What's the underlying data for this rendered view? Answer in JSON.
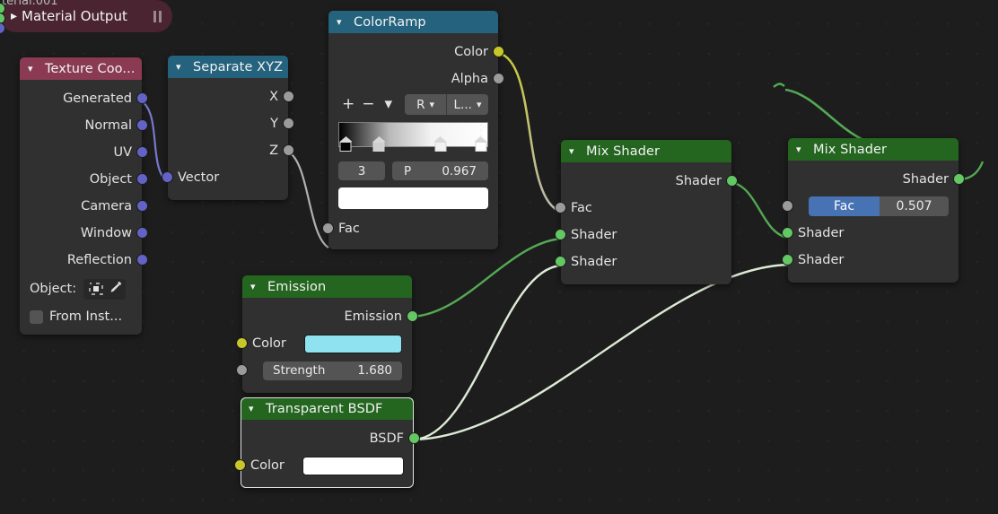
{
  "editor": {
    "breadcrumb_text": "terial.001",
    "background_color": "#1d1d1d"
  },
  "nodes": {
    "texture_coordinate": {
      "title": "Texture Coo...",
      "header_color": "#8a3a53",
      "outputs": [
        "Generated",
        "Normal",
        "UV",
        "Object",
        "Camera",
        "Window",
        "Reflection"
      ],
      "object_label": "Object:",
      "from_instancer_label": "From Inst...",
      "object_icon": "object-icon",
      "eyedropper_icon": "eyedropper-icon"
    },
    "separate_xyz": {
      "title": "Separate XYZ",
      "header_color": "#24627d",
      "outputs": [
        "X",
        "Y",
        "Z"
      ],
      "inputs": [
        "Vector"
      ]
    },
    "colorramp": {
      "title": "ColorRamp",
      "header_color": "#24627d",
      "outputs": [
        "Color",
        "Alpha"
      ],
      "inputs": [
        "Fac"
      ],
      "add_label": "+",
      "remove_label": "−",
      "tools_menu_label": "",
      "color_mode": "R",
      "interpolation": "L...",
      "active_index": "3",
      "position_label": "P",
      "position_value": "0.967",
      "selected_color": "#ffffff",
      "gradient_from": "#000000",
      "gradient_to": "#ffffff",
      "stops": [
        {
          "position": 0.02,
          "color": "#000000"
        },
        {
          "position": 0.28,
          "color": "#c6c6c6"
        },
        {
          "position": 0.7,
          "color": "#efefef"
        },
        {
          "position": 0.965,
          "color": "#ffffff"
        }
      ]
    },
    "emission": {
      "title": "Emission",
      "header_color": "#24661f",
      "outputs": [
        "Emission"
      ],
      "color_label": "Color",
      "color_value": "#8fe2ef",
      "strength_label": "Strength",
      "strength_value": "1.680"
    },
    "transparent_bsdf": {
      "title": "Transparent BSDF",
      "header_color": "#24661f",
      "outputs": [
        "BSDF"
      ],
      "color_label": "Color",
      "color_value": "#ffffff",
      "selected": true
    },
    "mix_shader_1": {
      "title": "Mix Shader",
      "header_color": "#24661f",
      "outputs": [
        "Shader"
      ],
      "inputs": [
        "Fac",
        "Shader",
        "Shader"
      ]
    },
    "mix_shader_2": {
      "title": "Mix Shader",
      "header_color": "#24661f",
      "outputs": [
        "Shader"
      ],
      "fac_label": "Fac",
      "fac_value": "0.507",
      "fac_fraction": 0.507,
      "inputs": [
        "Shader",
        "Shader"
      ]
    },
    "material_output": {
      "title": "Material Output",
      "header_color": "#4a2430",
      "collapsed": true,
      "expand_icon": "chevron-right-icon",
      "pause_icon": "pause-icon"
    }
  },
  "socket_colors": {
    "vector": "#6363c7",
    "value": "#9b9b9b",
    "color": "#c7c729",
    "shader": "#63c763"
  },
  "link_colors": {
    "vector": "#7878cc",
    "value": "#b0b0b0",
    "color_to_value": "#c9c93a",
    "shader": "#54a854",
    "shader_selected": "#dcebd6"
  }
}
